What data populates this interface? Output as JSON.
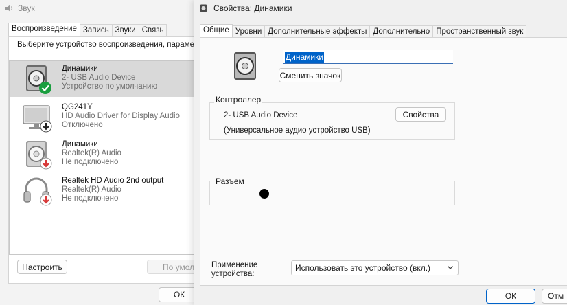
{
  "sound_window": {
    "title": "Звук",
    "tabs": [
      "Воспроизведение",
      "Запись",
      "Звуки",
      "Связь"
    ],
    "instruction": "Выберите устройство воспроизведения, параме изменить:",
    "devices": [
      {
        "name": "Динамики",
        "driver": "2- USB Audio Device",
        "status": "Устройство по умолчанию",
        "icon": "speaker-icon",
        "badge": "default-check-icon"
      },
      {
        "name": "QG241Y",
        "driver": "HD Audio Driver for Display Audio",
        "status": "Отключено",
        "icon": "monitor-icon",
        "badge": "disabled-arrow-icon"
      },
      {
        "name": "Динамики",
        "driver": "Realtek(R) Audio",
        "status": "Не подключено",
        "icon": "speaker-icon",
        "badge": "unplugged-arrow-icon"
      },
      {
        "name": "Realtek HD Audio 2nd output",
        "driver": "Realtek(R) Audio",
        "status": "Не подключено",
        "icon": "headphones-icon",
        "badge": "unplugged-arrow-icon"
      }
    ],
    "configure_button": "Настроить",
    "default_button": "По умол",
    "ok_button": "ОК"
  },
  "properties_window": {
    "title": "Свойства: Динамики",
    "tabs": [
      "Общие",
      "Уровни",
      "Дополнительные эффекты",
      "Дополнительно",
      "Пространственный звук"
    ],
    "device_name": "Динамики",
    "change_icon_button": "Сменить значок",
    "controller": {
      "label": "Контроллер",
      "name": "2- USB Audio Device",
      "properties_button": "Свойства",
      "description": "(Универсальное аудио устройство USB)"
    },
    "jack": {
      "label": "Разъем"
    },
    "usage": {
      "label_line1": "Применение",
      "label_line2": "устройства:",
      "selected": "Использовать это устройство (вкл.)"
    },
    "ok_button": "ОК",
    "cancel_button": "Отм"
  },
  "colors": {
    "accent": "#0063c9",
    "success": "#1a9e3f",
    "error": "#d83a3a",
    "selected_row": "#d9d9d9"
  }
}
